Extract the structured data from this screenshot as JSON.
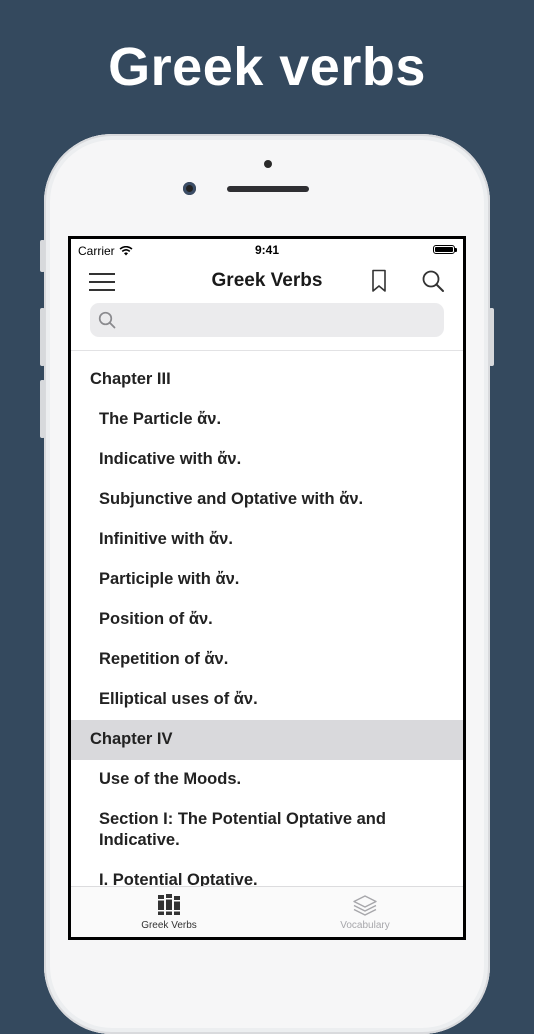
{
  "headline": "Greek verbs",
  "status": {
    "carrier": "Carrier",
    "time": "9:41"
  },
  "nav": {
    "title": "Greek Verbs"
  },
  "search": {
    "placeholder": ""
  },
  "list": [
    {
      "label": "Chapter III",
      "type": "chapter",
      "selected": false
    },
    {
      "label": "The Particle ἄν.",
      "type": "item",
      "selected": false
    },
    {
      "label": "Indicative with ἄν.",
      "type": "item",
      "selected": false
    },
    {
      "label": "Subjunctive and Optative with ἄν.",
      "type": "item",
      "selected": false
    },
    {
      "label": "Infinitive with ἄν.",
      "type": "item",
      "selected": false
    },
    {
      "label": "Participle with ἄν.",
      "type": "item",
      "selected": false
    },
    {
      "label": "Position of ἄν.",
      "type": "item",
      "selected": false
    },
    {
      "label": "Repetition of ἄν.",
      "type": "item",
      "selected": false
    },
    {
      "label": "Elliptical uses of ἄν.",
      "type": "item",
      "selected": false
    },
    {
      "label": "Chapter IV",
      "type": "chapter",
      "selected": true
    },
    {
      "label": "Use of the Moods.",
      "type": "item",
      "selected": false
    },
    {
      "label": "Section I: The Potential Optative and Indicative.",
      "type": "item",
      "selected": false
    },
    {
      "label": "I. Potential Optative.",
      "type": "item",
      "selected": false
    }
  ],
  "tabs": [
    {
      "label": "Greek Verbs",
      "icon": "books-icon",
      "active": true
    },
    {
      "label": "Vocabulary",
      "icon": "layers-icon",
      "active": false
    }
  ],
  "colors": {
    "background": "#34495e",
    "selected_row": "#d9d9dc"
  }
}
